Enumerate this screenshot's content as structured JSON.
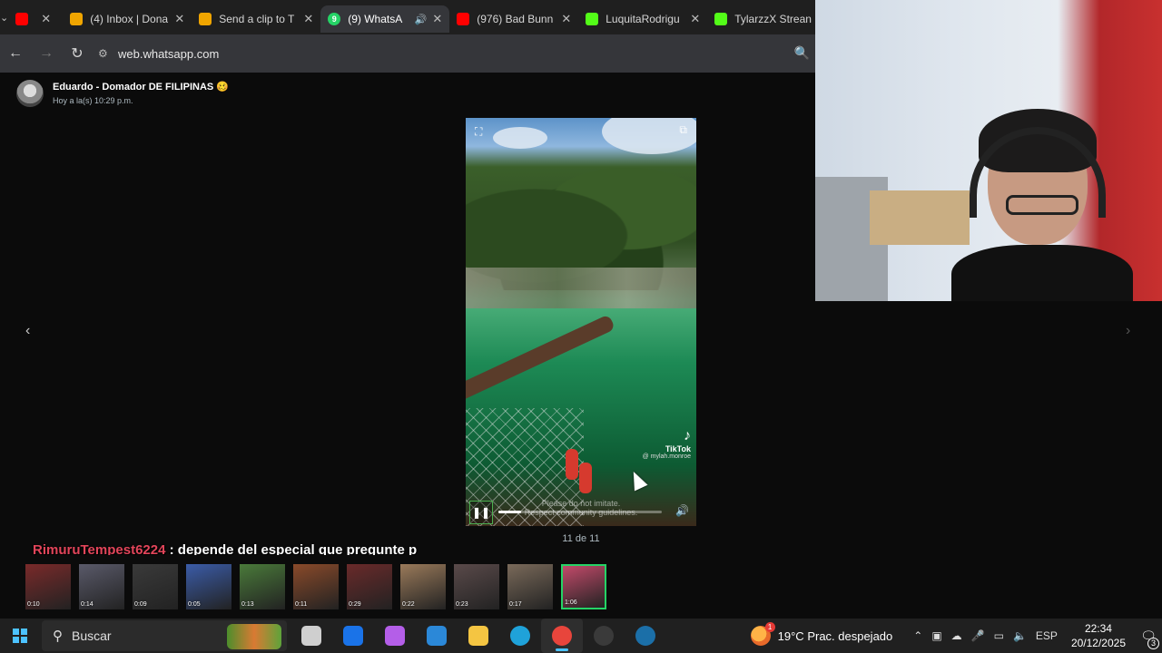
{
  "browser": {
    "tabs": [
      {
        "title": "",
        "favicon": "youtube-icon",
        "color": "#ff0000"
      },
      {
        "title": "(4) Inbox | Dona",
        "favicon": "streamlabs-icon",
        "color": "#f0a500"
      },
      {
        "title": "Send a clip to T",
        "favicon": "streamlabs-icon",
        "color": "#f0a500"
      },
      {
        "title": "(9) WhatsA",
        "favicon": "whatsapp-icon",
        "color": "#25d366",
        "active": true
      },
      {
        "title": "(976) Bad Bunn",
        "favicon": "youtube-icon",
        "color": "#ff0000"
      },
      {
        "title": "LuquitaRodrigu",
        "favicon": "kick-icon",
        "color": "#53fc18"
      },
      {
        "title": "TylarzzX Strean",
        "favicon": "kick-icon",
        "color": "#53fc18"
      }
    ],
    "tab_badge": "9",
    "url": "web.whatsapp.com"
  },
  "viewer": {
    "contact_name": "Eduardo - Domador DE FILIPINAS 🥴",
    "timestamp": "Hoy a la(s) 10:29 p.m.",
    "counter": "11 de 11",
    "video": {
      "watermark_name": "TikTok",
      "watermark_user": "@ mylah.monroe",
      "disclaimer_line1": "Please do not imitate.",
      "disclaimer_line2": "Respect community guidelines.",
      "progress": 0.14
    },
    "thumbnails": [
      {
        "duration": "0:10",
        "color": "#7a2a2a"
      },
      {
        "duration": "0:14",
        "color": "#5a5a6a"
      },
      {
        "duration": "0:09",
        "color": "#3a3a3a"
      },
      {
        "duration": "0:05",
        "color": "#3b5ca8"
      },
      {
        "duration": "0:13",
        "color": "#4a7a3a"
      },
      {
        "duration": "0:11",
        "color": "#8a4a2a"
      },
      {
        "duration": "0:29",
        "color": "#6a2a2a"
      },
      {
        "duration": "0:22",
        "color": "#9a7a5a"
      },
      {
        "duration": "0:23",
        "color": "#5a4a4a"
      },
      {
        "duration": "0:17",
        "color": "#7a6a5a"
      },
      {
        "duration": "1:06",
        "color": "#c24a6a",
        "active": true
      }
    ]
  },
  "chat_overlay": {
    "username": "RimuruTempest6224",
    "message": " : depende del especial que pregunte p"
  },
  "taskbar": {
    "search_placeholder": "Buscar",
    "temperature": "19°C",
    "weather": "Prac. despejado",
    "weather_badge": "1",
    "language": "ESP",
    "time": "22:34",
    "date": "20/12/2025",
    "notification_count": "3",
    "apps": [
      {
        "name": "task-view-icon",
        "color": "#cfcfcf"
      },
      {
        "name": "outlook-icon",
        "color": "#1a73e8"
      },
      {
        "name": "copilot-icon",
        "color": "#b45ee8"
      },
      {
        "name": "store-icon",
        "color": "#2b88d8"
      },
      {
        "name": "file-explorer-icon",
        "color": "#f4c542"
      },
      {
        "name": "edge-icon",
        "color": "#1fa2d9"
      },
      {
        "name": "chrome-icon",
        "color": "#e8453c",
        "active": true
      },
      {
        "name": "obs-icon",
        "color": "#3a3a3a"
      },
      {
        "name": "steam-icon",
        "color": "#1b6fa8"
      }
    ]
  }
}
